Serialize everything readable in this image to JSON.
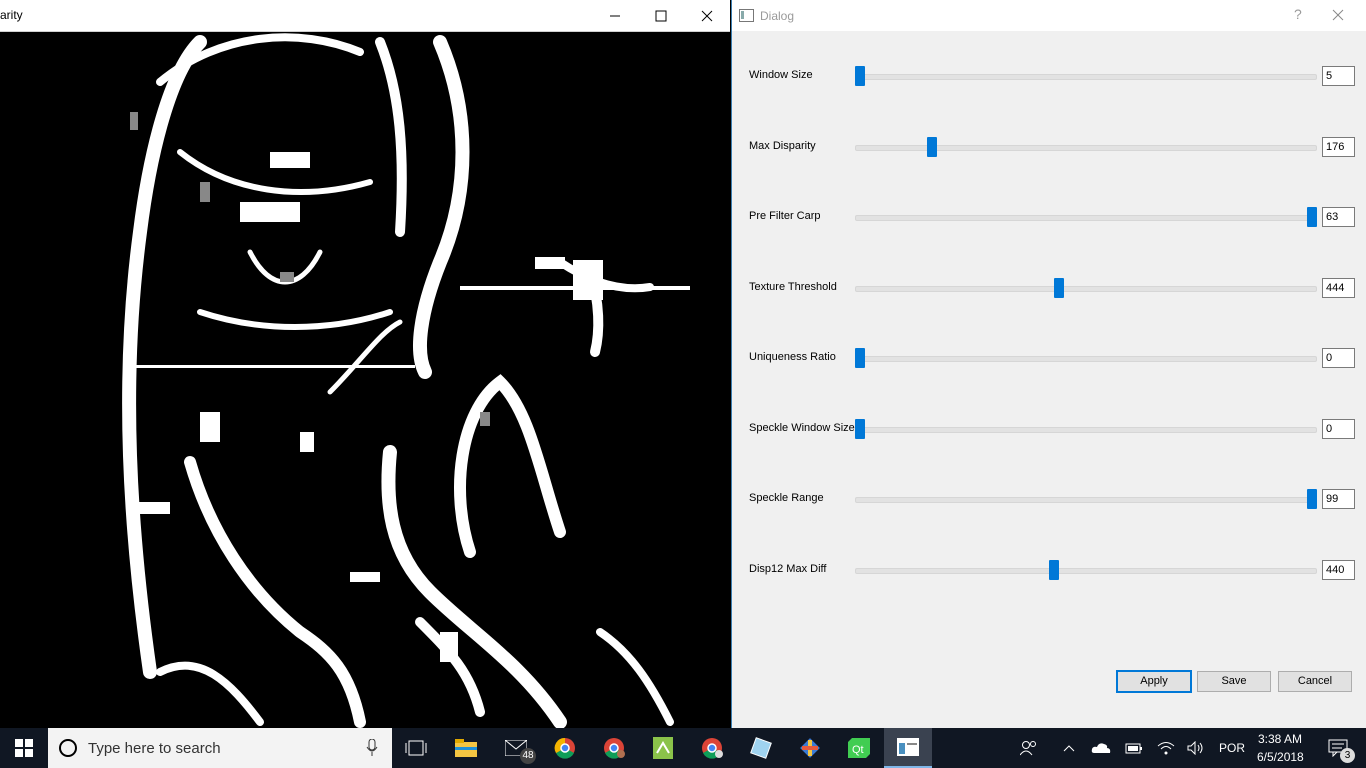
{
  "left_window": {
    "title": "arity"
  },
  "dialog": {
    "title": "Dialog",
    "help_glyph": "?",
    "params": [
      {
        "label": "Window Size",
        "value": "5",
        "level": 0.0
      },
      {
        "label": "Max Disparity",
        "value": "176",
        "level": 0.16
      },
      {
        "label": "Pre Filter Carp",
        "value": "63",
        "level": 1.0
      },
      {
        "label": "Texture Threshold",
        "value": "444",
        "level": 0.44
      },
      {
        "label": "Uniqueness Ratio",
        "value": "0",
        "level": 0.0
      },
      {
        "label": "Speckle Window Size",
        "value": "0",
        "level": 0.0
      },
      {
        "label": "Speckle Range",
        "value": "99",
        "level": 1.0
      },
      {
        "label": "Disp12 Max Diff",
        "value": "440",
        "level": 0.43
      }
    ],
    "buttons": {
      "apply": "Apply",
      "save": "Save",
      "cancel": "Cancel"
    }
  },
  "taskbar": {
    "search_placeholder": "Type here to search",
    "mail_badge": "48",
    "language": "POR",
    "time": "3:38 AM",
    "date": "6/5/2018",
    "notification_count": "3"
  },
  "colors": {
    "accent": "#0078d7",
    "taskbar": "#101723",
    "dialog_bg": "#f0f0f0"
  }
}
